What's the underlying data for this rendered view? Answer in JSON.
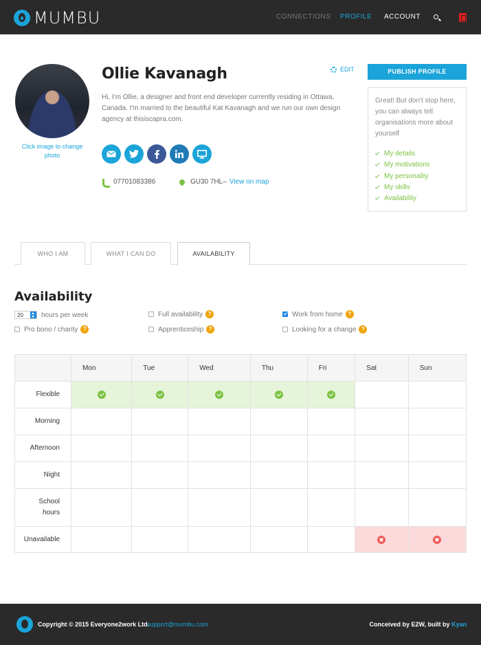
{
  "brand": {
    "name": "MUMBU",
    "accent": "#1ba4d9",
    "green": "#7cc242",
    "orange": "#f0a30a",
    "red": "#ef5b5b"
  },
  "nav": {
    "connections": "CONNECTIONS",
    "profile": "PROFILE",
    "account": "ACCOUNT",
    "search_icon": "search-icon",
    "exit_icon": "logout-icon"
  },
  "profile": {
    "name": "Ollie Kavanagh",
    "photo_caption": "Click image to change photo",
    "edit_label": "EDIT",
    "bio": "Hi, I'm Ollie, a designer and front end developer currently residing in Ottawa, Canada. I'm married to the beautiful Kat Kavanagh and we run our own design agency at thisiscapra.com.",
    "phone": "07701083386",
    "postcode": "GU30 7HL",
    "location_sep": " –",
    "map_link": "View on map",
    "socials": [
      {
        "name": "email-icon",
        "color": "#1ba4d9"
      },
      {
        "name": "twitter-icon",
        "color": "#1ba4d9"
      },
      {
        "name": "facebook-icon",
        "color": "#3b5998"
      },
      {
        "name": "linkedin-icon",
        "color": "#1f7bb6"
      },
      {
        "name": "website-icon",
        "color": "#1ba4d9"
      }
    ]
  },
  "sidebar": {
    "publish_label": "PUBLISH PROFILE",
    "tip": "Great! But don't stop here, you can always tell organisations more about yourself",
    "checklist": [
      "My details",
      "My motivations",
      "My personality",
      "My skills",
      "Availability"
    ]
  },
  "tabs": [
    "WHO I AM",
    "WHAT I CAN DO",
    "AVAILABILITY"
  ],
  "availability": {
    "title": "Availability",
    "hours_value": "20",
    "hours_label": "hours per week",
    "options": {
      "full": {
        "label": "Full availability",
        "checked": false
      },
      "home": {
        "label": "Work from home",
        "checked": true
      },
      "probono": {
        "label": "Pro bono / charity",
        "checked": false
      },
      "apprentice": {
        "label": "Apprenticeship",
        "checked": false
      },
      "change": {
        "label": "Looking for a change",
        "checked": false
      }
    },
    "help_glyph": "?",
    "days": [
      "Mon",
      "Tue",
      "Wed",
      "Thu",
      "Fri",
      "Sat",
      "Sun"
    ],
    "rows": [
      {
        "label": "Flexible",
        "cells": [
          "yes",
          "yes",
          "yes",
          "yes",
          "yes",
          "",
          ""
        ]
      },
      {
        "label": "Morning",
        "cells": [
          "",
          "",
          "",
          "",
          "",
          "",
          ""
        ]
      },
      {
        "label": "Afternoon",
        "cells": [
          "",
          "",
          "",
          "",
          "",
          "",
          ""
        ]
      },
      {
        "label": "Night",
        "cells": [
          "",
          "",
          "",
          "",
          "",
          "",
          ""
        ]
      },
      {
        "label": "School hours",
        "cells": [
          "",
          "",
          "",
          "",
          "",
          "",
          ""
        ]
      },
      {
        "label": "Unavailable",
        "cells": [
          "",
          "",
          "",
          "",
          "",
          "no",
          "no"
        ]
      }
    ]
  },
  "footer": {
    "copyright": "Copyright © 2015 Everyone2work Ltd.",
    "email": "support@mumbu.com",
    "credit_prefix": "Conceived by E2W, built by ",
    "credit_link": "Kyan"
  }
}
